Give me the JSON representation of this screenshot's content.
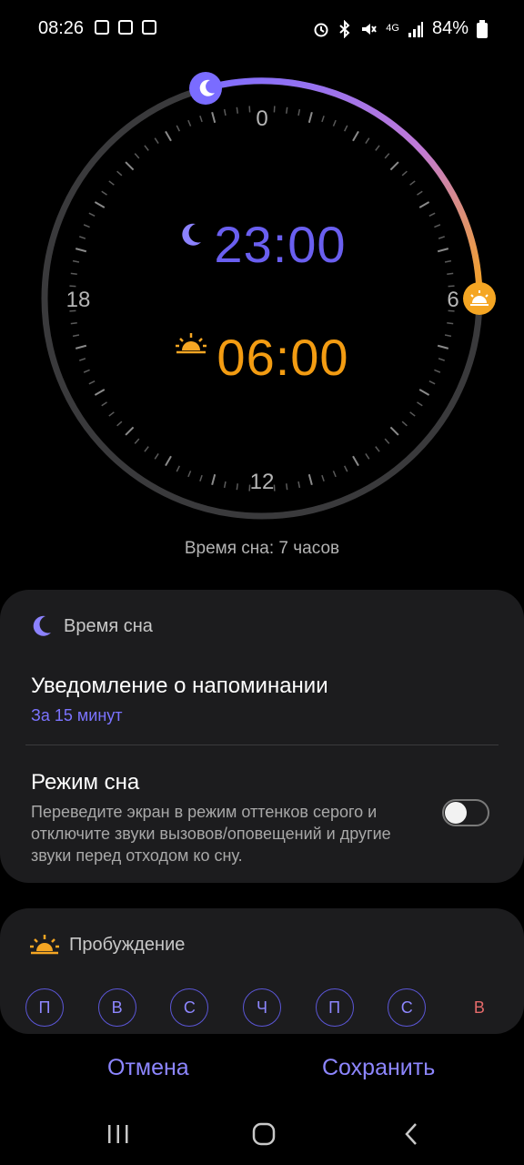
{
  "status_bar": {
    "time": "08:26",
    "battery": "84%",
    "network": "4G"
  },
  "dial": {
    "label_top": "0",
    "label_right": "6",
    "label_bottom": "12",
    "label_left": "18",
    "bedtime": "23:00",
    "wake_time": "06:00",
    "bed_color": "#6c63ff",
    "wake_color": "#f5a623"
  },
  "sleep_duration": "Время сна: 7 часов",
  "bedtime_card": {
    "header": "Время сна",
    "reminder_title": "Уведомление о напоминании",
    "reminder_value": "За 15 минут",
    "sleep_mode_title": "Режим сна",
    "sleep_mode_desc": "Переведите экран в режим оттенков серого и отключите звуки вызовов/оповещений и другие звуки перед отходом ко сну.",
    "sleep_mode_on": false
  },
  "wake_card": {
    "header": "Пробуждение",
    "days": [
      "П",
      "В",
      "С",
      "Ч",
      "П",
      "С",
      "В"
    ]
  },
  "actions": {
    "cancel": "Отмена",
    "save": "Сохранить"
  }
}
